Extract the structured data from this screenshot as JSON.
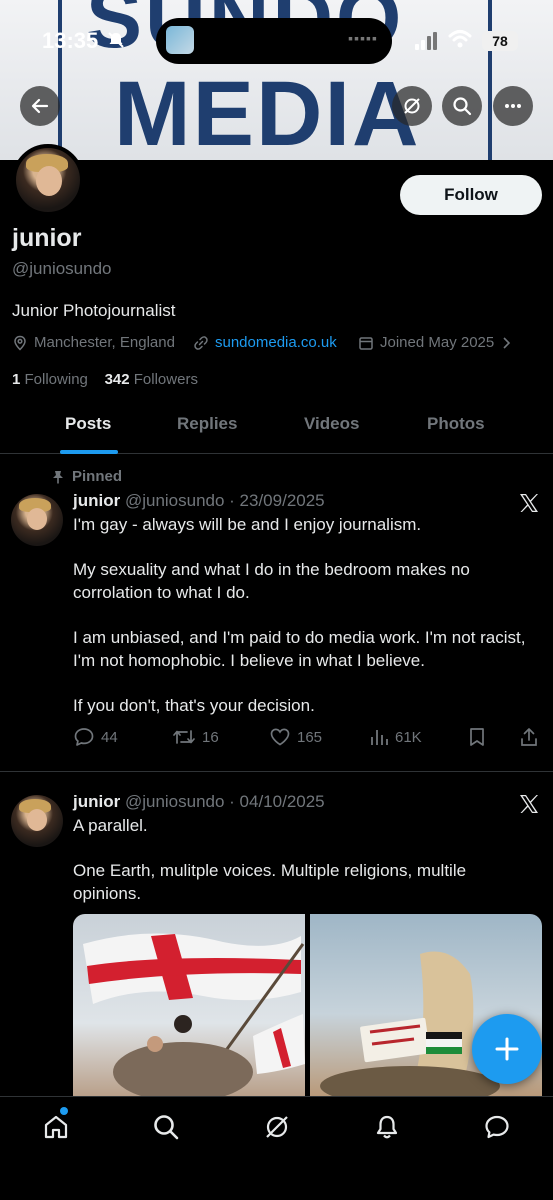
{
  "status_bar": {
    "time": "13:35",
    "battery": "78"
  },
  "banner": {
    "line1": "SUNDO",
    "line2": "MEDIA"
  },
  "profile": {
    "display_name": "junior",
    "handle": "@juniosundo",
    "bio": "Junior Photojournalist",
    "location": "Manchester, England",
    "website": "sundomedia.co.uk",
    "joined": "Joined May 2025",
    "following_count": "1",
    "following_label": "Following",
    "followers_count": "342",
    "followers_label": "Followers",
    "follow_button": "Follow"
  },
  "tabs": [
    "Posts",
    "Replies",
    "Videos",
    "Photos"
  ],
  "active_tab": "Posts",
  "posts": [
    {
      "pinned_label": "Pinned",
      "name": "junior",
      "handle_date": "@juniosundo · 23/09/2025",
      "text": "I'm gay - always will be and I enjoy journalism.\n\nMy sexuality and what I do in the bedroom makes no corrolation to what I do.\n\nI am unbiased, and I'm paid to do media work. I'm not racist, I'm not homophobic. I believe in what I believe.\n\nIf you don't, that's your decision.",
      "replies": "44",
      "reposts": "16",
      "likes": "165",
      "views": "61K"
    },
    {
      "name": "junior",
      "handle_date": "@juniosundo · 04/10/2025",
      "text": "A parallel.\n\nOne Earth, mulitple voices. Multiple religions, multile opinions."
    }
  ],
  "icons": {
    "back": "arrow-left-icon",
    "grok": "grok-icon",
    "search": "search-icon",
    "more": "more-icon",
    "compose": "plus-icon",
    "nav": [
      "home-icon",
      "search-icon",
      "grok-icon",
      "bell-icon",
      "messages-icon"
    ]
  },
  "colors": {
    "accent": "#1d9bf0",
    "banner_text": "#1f3e6f",
    "background": "#000000"
  }
}
